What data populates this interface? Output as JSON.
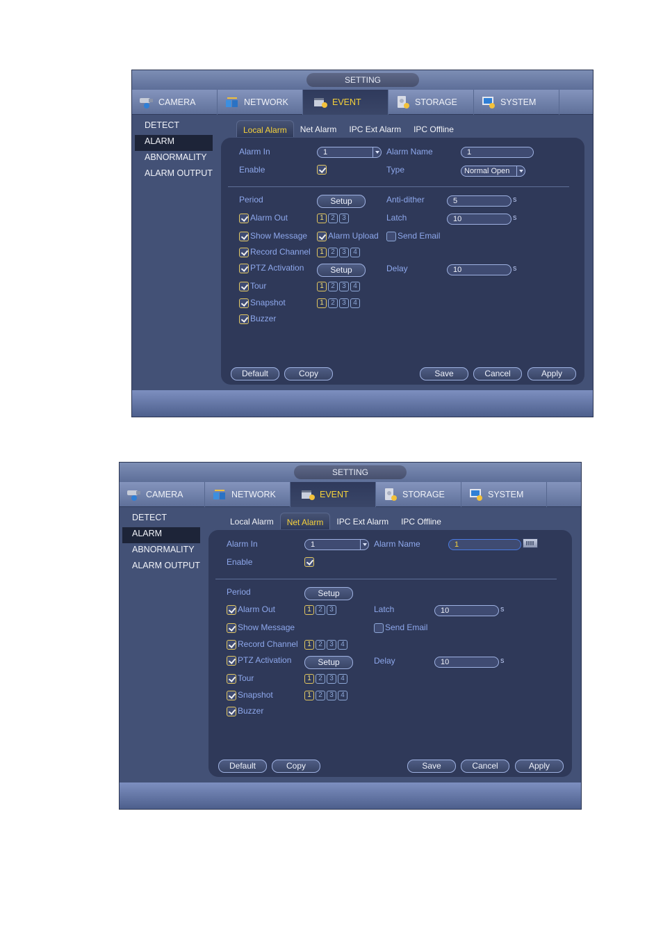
{
  "windows": [
    {
      "title": "SETTING",
      "nav": [
        {
          "label": "CAMERA",
          "icon": "camera-icon"
        },
        {
          "label": "NETWORK",
          "icon": "network-icon"
        },
        {
          "label": "EVENT",
          "icon": "event-icon",
          "active": true
        },
        {
          "label": "STORAGE",
          "icon": "storage-icon"
        },
        {
          "label": "SYSTEM",
          "icon": "system-icon"
        }
      ],
      "sidebar": [
        "DETECT",
        "ALARM",
        "ABNORMALITY",
        "ALARM OUTPUT"
      ],
      "sidebar_active": "ALARM",
      "subtabs": [
        "Local Alarm",
        "Net Alarm",
        "IPC Ext Alarm",
        "IPC Offline"
      ],
      "subtab_active": "Local Alarm",
      "form": {
        "alarm_in_label": "Alarm In",
        "alarm_in_value": "1",
        "alarm_name_label": "Alarm Name",
        "alarm_name_value": "1",
        "enable_label": "Enable",
        "enable_checked": true,
        "type_label": "Type",
        "type_value": "Normal Open",
        "period_label": "Period",
        "setup_label": "Setup",
        "anti_dither_label": "Anti-dither",
        "anti_dither_value": "5",
        "latch_label": "Latch",
        "latch_value": "10",
        "delay_label": "Delay",
        "delay_value": "10",
        "unit": "s",
        "alarm_out_label": "Alarm Out",
        "alarm_out_channels": [
          "1",
          "2",
          "3"
        ],
        "alarm_out_selected": [
          "1"
        ],
        "show_message_label": "Show Message",
        "alarm_upload_label": "Alarm Upload",
        "send_email_label": "Send Email",
        "send_email_checked": false,
        "record_channel_label": "Record Channel",
        "record_channels": [
          "1",
          "2",
          "3",
          "4"
        ],
        "record_selected": [
          "1"
        ],
        "ptz_label": "PTZ Activation",
        "tour_label": "Tour",
        "tour_channels": [
          "1",
          "2",
          "3",
          "4"
        ],
        "tour_selected": [
          "1"
        ],
        "snapshot_label": "Snapshot",
        "snapshot_channels": [
          "1",
          "2",
          "3",
          "4"
        ],
        "snapshot_selected": [
          "1"
        ],
        "buzzer_label": "Buzzer"
      },
      "buttons": {
        "default": "Default",
        "copy": "Copy",
        "save": "Save",
        "cancel": "Cancel",
        "apply": "Apply"
      }
    },
    {
      "title": "SETTING",
      "nav": [
        {
          "label": "CAMERA",
          "icon": "camera-icon"
        },
        {
          "label": "NETWORK",
          "icon": "network-icon"
        },
        {
          "label": "EVENT",
          "icon": "event-icon",
          "active": true
        },
        {
          "label": "STORAGE",
          "icon": "storage-icon"
        },
        {
          "label": "SYSTEM",
          "icon": "system-icon"
        }
      ],
      "sidebar": [
        "DETECT",
        "ALARM",
        "ABNORMALITY",
        "ALARM OUTPUT"
      ],
      "sidebar_active": "ALARM",
      "subtabs": [
        "Local Alarm",
        "Net Alarm",
        "IPC Ext Alarm",
        "IPC Offline"
      ],
      "subtab_active": "Net Alarm",
      "form": {
        "alarm_in_label": "Alarm In",
        "alarm_in_value": "1",
        "alarm_name_label": "Alarm Name",
        "alarm_name_value": "1",
        "enable_label": "Enable",
        "enable_checked": true,
        "period_label": "Period",
        "setup_label": "Setup",
        "latch_label": "Latch",
        "latch_value": "10",
        "delay_label": "Delay",
        "delay_value": "10",
        "unit": "s",
        "alarm_out_label": "Alarm Out",
        "alarm_out_channels": [
          "1",
          "2",
          "3"
        ],
        "alarm_out_selected": [
          "1"
        ],
        "show_message_label": "Show Message",
        "send_email_label": "Send Email",
        "send_email_checked": false,
        "record_channel_label": "Record Channel",
        "record_channels": [
          "1",
          "2",
          "3",
          "4"
        ],
        "record_selected": [
          "1"
        ],
        "ptz_label": "PTZ Activation",
        "tour_label": "Tour",
        "tour_channels": [
          "1",
          "2",
          "3",
          "4"
        ],
        "tour_selected": [
          "1"
        ],
        "snapshot_label": "Snapshot",
        "snapshot_channels": [
          "1",
          "2",
          "3",
          "4"
        ],
        "snapshot_selected": [
          "1"
        ],
        "buzzer_label": "Buzzer"
      },
      "buttons": {
        "default": "Default",
        "copy": "Copy",
        "save": "Save",
        "cancel": "Cancel",
        "apply": "Apply"
      }
    }
  ],
  "colors": {
    "accent_yellow": "#f6d23a",
    "label_blue": "#8ea8ec",
    "panel_bg": "#2f3959",
    "window_bg": "#435176"
  }
}
